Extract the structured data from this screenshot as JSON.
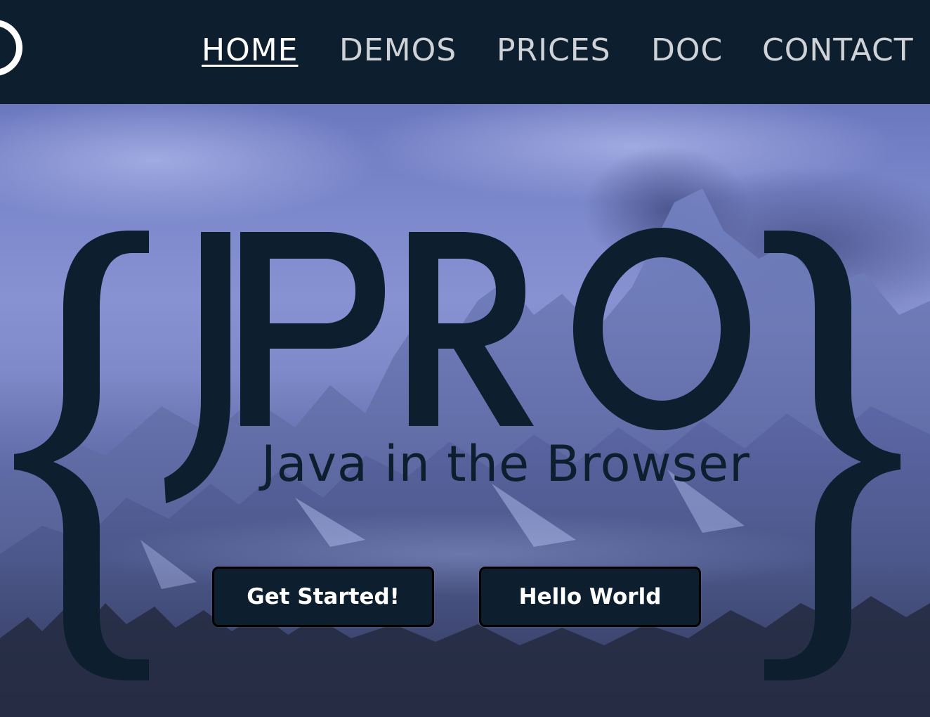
{
  "nav": {
    "items": [
      {
        "label": "HOME",
        "active": true
      },
      {
        "label": "DEMOS",
        "active": false
      },
      {
        "label": "PRICES",
        "active": false
      },
      {
        "label": "DOC",
        "active": false
      },
      {
        "label": "CONTACT",
        "active": false
      }
    ]
  },
  "hero": {
    "logo_text": "JPRO",
    "tagline": "Java in the Browser",
    "buttons": {
      "get_started": "Get Started!",
      "hello_world": "Hello World"
    }
  },
  "colors": {
    "navbar_bg": "#0d1f2f",
    "brand_dark": "#0d1f2f",
    "nav_text": "#cfd3d8",
    "nav_active": "#ffffff",
    "hero_tint": "#7c89cc"
  },
  "icons": {
    "logo": "ring-logo-icon",
    "left_brace": "left-curly-brace-icon",
    "right_brace": "right-curly-brace-icon"
  }
}
